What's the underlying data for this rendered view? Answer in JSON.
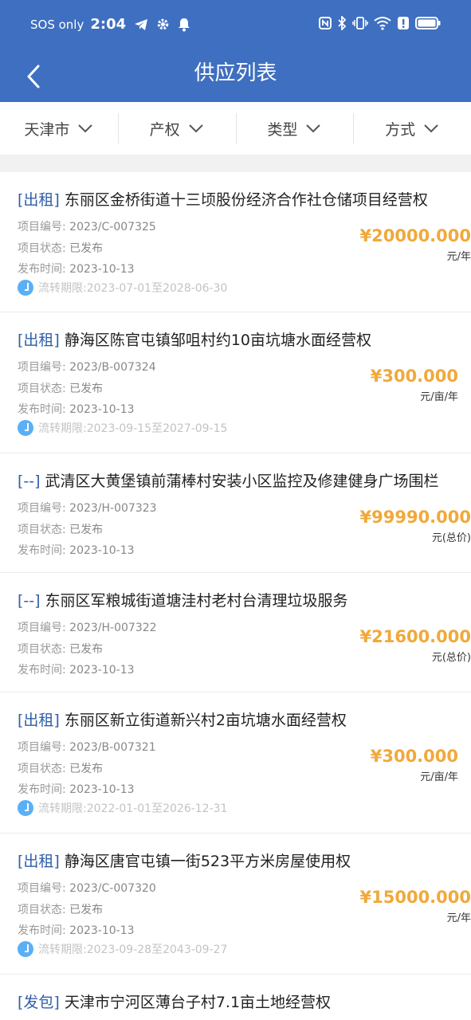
{
  "status_bar": {
    "carrier": "SOS only",
    "time": "2:04"
  },
  "header": {
    "title": "供应列表"
  },
  "filters": [
    {
      "label": "天津市"
    },
    {
      "label": "产权"
    },
    {
      "label": "类型"
    },
    {
      "label": "方式"
    }
  ],
  "labels": {
    "code": "项目编号:",
    "status": "项目状态:",
    "published": "发布时间:",
    "period_prefix": "流转期限:",
    "period_sep": "至"
  },
  "items": [
    {
      "tag": "[出租]",
      "title": "东丽区金桥街道十三顷股份经济合作社仓储项目经营权",
      "code": "2023/C-007325",
      "status": "已发布",
      "published": "2023-10-13",
      "period_start": "2023-07-01",
      "period_end": "2028-06-30",
      "price": "¥20000.000",
      "unit": "元/年"
    },
    {
      "tag": "[出租]",
      "title": "静海区陈官屯镇邹咀村约10亩坑塘水面经营权",
      "code": "2023/B-007324",
      "status": "已发布",
      "published": "2023-10-13",
      "period_start": "2023-09-15",
      "period_end": "2027-09-15",
      "price": "¥300.000",
      "unit": "元/亩/年"
    },
    {
      "tag": "[--]",
      "title": "武清区大黄堡镇前蒲棒村安装小区监控及修建健身广场围栏",
      "code": "2023/H-007323",
      "status": "已发布",
      "published": "2023-10-13",
      "period_start": "",
      "period_end": "",
      "price": "¥99990.000",
      "unit": "元(总价)"
    },
    {
      "tag": "[--]",
      "title": "东丽区军粮城街道塘洼村老村台清理垃圾服务",
      "code": "2023/H-007322",
      "status": "已发布",
      "published": "2023-10-13",
      "period_start": "",
      "period_end": "",
      "price": "¥21600.000",
      "unit": "元(总价)"
    },
    {
      "tag": "[出租]",
      "title": "东丽区新立街道新兴村2亩坑塘水面经营权",
      "code": "2023/B-007321",
      "status": "已发布",
      "published": "2023-10-13",
      "period_start": "2022-01-01",
      "period_end": "2026-12-31",
      "price": "¥300.000",
      "unit": "元/亩/年"
    },
    {
      "tag": "[出租]",
      "title": "静海区唐官屯镇一街523平方米房屋使用权",
      "code": "2023/C-007320",
      "status": "已发布",
      "published": "2023-10-13",
      "period_start": "2023-09-28",
      "period_end": "2043-09-27",
      "price": "¥15000.000",
      "unit": "元/年"
    },
    {
      "tag": "[发包]",
      "title": "天津市宁河区薄台子村7.1亩土地经营权",
      "code": "",
      "status": "",
      "published": "",
      "period_start": "",
      "period_end": "",
      "price": "",
      "unit": ""
    }
  ]
}
